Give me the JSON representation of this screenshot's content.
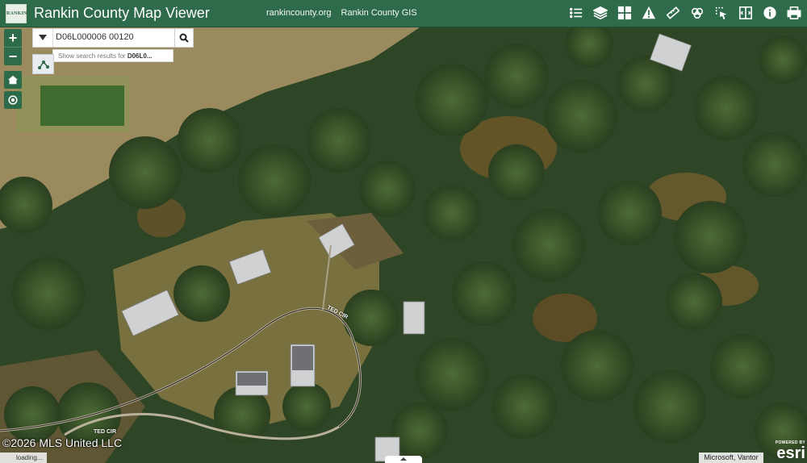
{
  "header": {
    "logo_text": "RANKIN",
    "title": "Rankin County Map Viewer",
    "links": [
      "rankincounty.org",
      "Rankin County GIS"
    ],
    "tools": [
      "layer-list-icon",
      "layers-icon",
      "basemap-gallery-icon",
      "warning-icon",
      "measure-icon",
      "analysis-icon",
      "select-icon",
      "swipe-icon",
      "info-icon",
      "print-icon"
    ]
  },
  "search": {
    "value": "D06L000006 00120",
    "suggestion_prefix": "Show search results for",
    "suggestion_term": "D06L0..."
  },
  "map": {
    "road_label": "TED CIR",
    "road_label_2": "TED CIR"
  },
  "footer": {
    "copyright": "©2026 MLS United LLC",
    "loading": "loading...",
    "attribution": "Microsoft, Vantor",
    "esri_powered": "POWERED BY",
    "esri_word": "esri"
  },
  "colors": {
    "header_bg": "#2e6b4a",
    "accent": "#2e6b4a"
  }
}
